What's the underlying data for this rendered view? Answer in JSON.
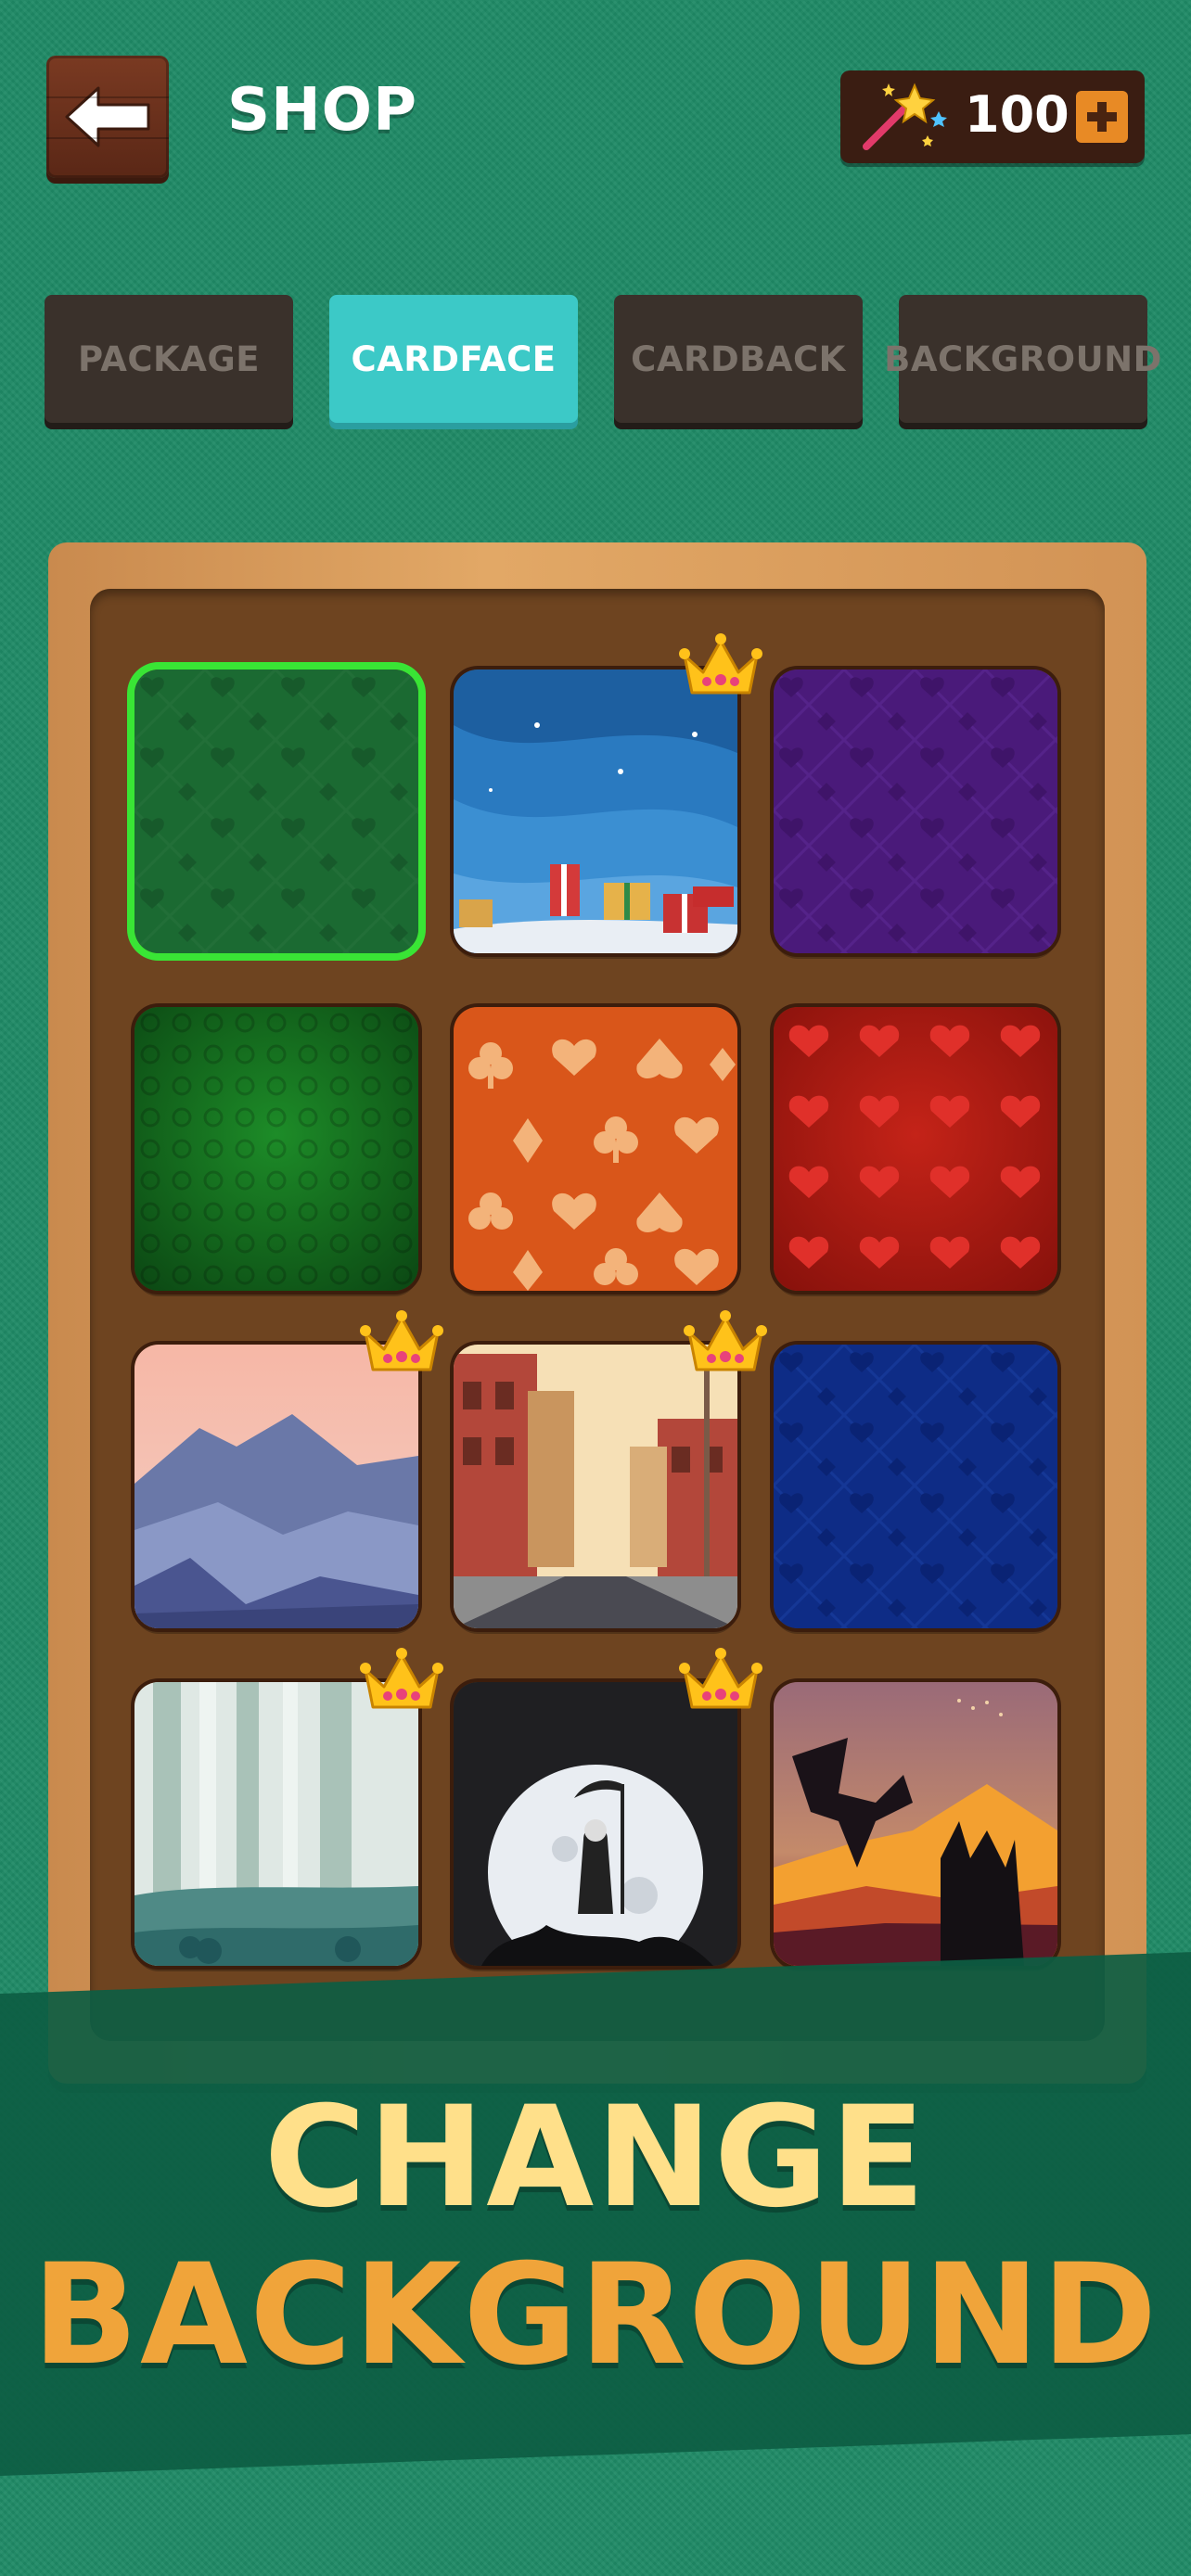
{
  "header": {
    "title": "SHOP",
    "coins": "100",
    "back_icon": "arrow-left-icon",
    "wand_icon": "magic-wand-icon",
    "plus_icon": "plus-icon"
  },
  "tabs": [
    {
      "label": "PACKAGE",
      "active": false
    },
    {
      "label": "CARDFACE",
      "active": true
    },
    {
      "label": "CARDBACK",
      "active": false
    },
    {
      "label": "BACKGROUND",
      "active": false
    }
  ],
  "items": [
    {
      "name": "green-suits-pattern",
      "selected": true,
      "premium": false
    },
    {
      "name": "winter-gifts",
      "selected": false,
      "premium": true
    },
    {
      "name": "purple-suits-pattern",
      "selected": false,
      "premium": false
    },
    {
      "name": "green-damask",
      "selected": false,
      "premium": false
    },
    {
      "name": "orange-suits",
      "selected": false,
      "premium": false
    },
    {
      "name": "red-hearts",
      "selected": false,
      "premium": false
    },
    {
      "name": "pink-mountains",
      "selected": false,
      "premium": true
    },
    {
      "name": "town-street",
      "selected": false,
      "premium": true
    },
    {
      "name": "blue-suits-pattern",
      "selected": false,
      "premium": false
    },
    {
      "name": "misty-forest",
      "selected": false,
      "premium": true
    },
    {
      "name": "reaper-moon",
      "selected": false,
      "premium": true
    },
    {
      "name": "dragon-sunset",
      "selected": false,
      "premium": false
    }
  ],
  "colors": {
    "selected_outline": "#39e535",
    "active_tab": "#3cc9c7",
    "headline_top": "#ffe08a",
    "headline_bottom": "#f0a43a"
  },
  "banner": {
    "line1": "CHANGE",
    "line2": "BACKGROUND"
  }
}
